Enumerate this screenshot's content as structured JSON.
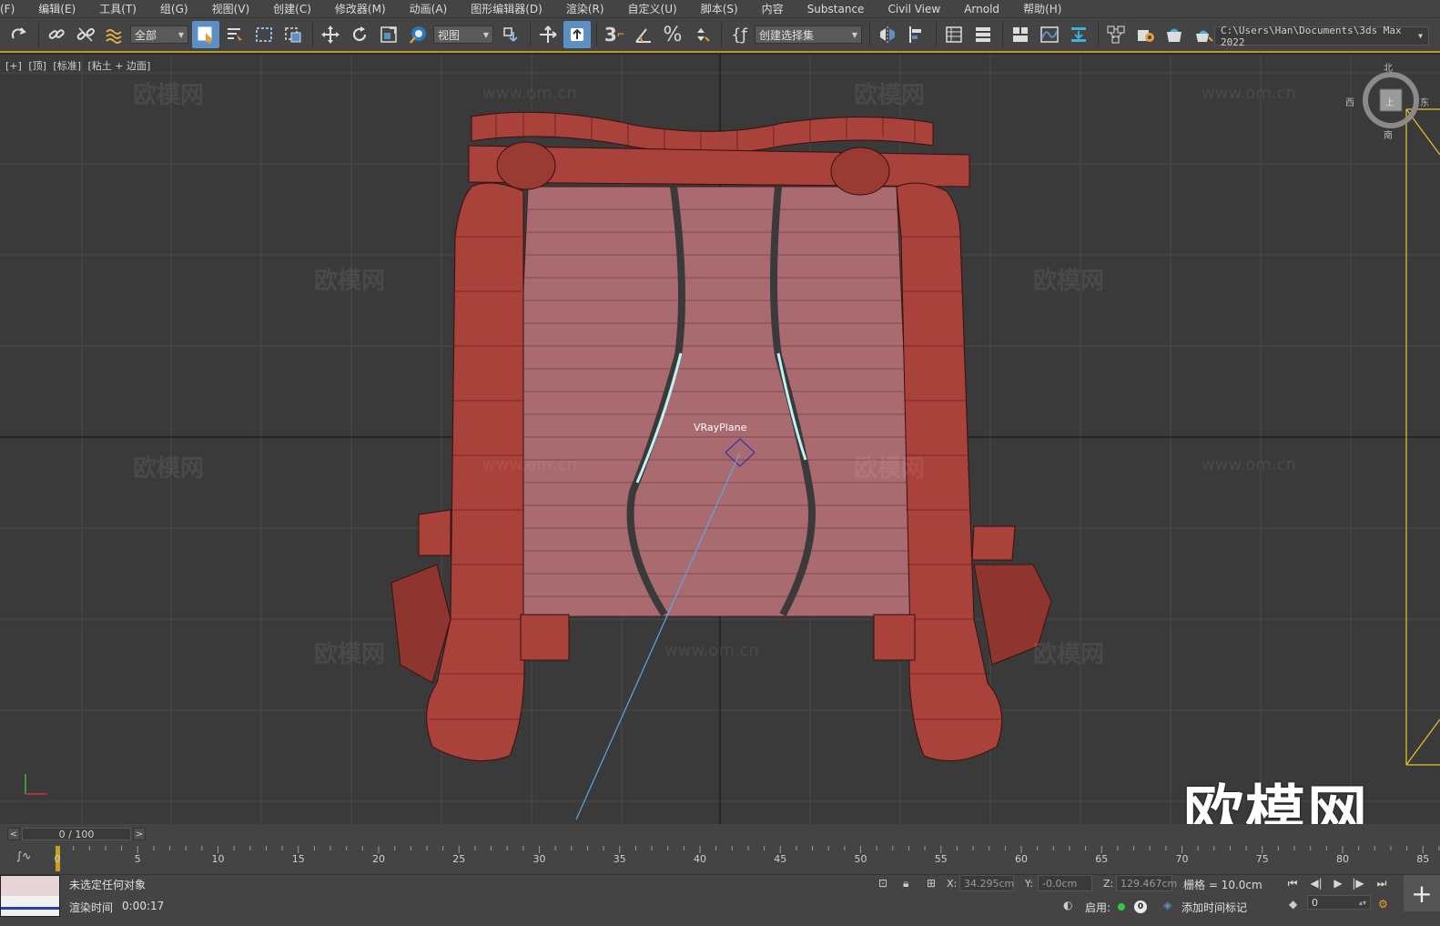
{
  "menu": [
    "(F)",
    "编辑(E)",
    "工具(T)",
    "组(G)",
    "视图(V)",
    "创建(C)",
    "修改器(M)",
    "动画(A)",
    "图形编辑器(D)",
    "渲染(R)",
    "自定义(U)",
    "脚本(S)",
    "内容",
    "Substance",
    "Civil View",
    "Arnold",
    "帮助(H)"
  ],
  "toolbar": {
    "filter_value": "全部",
    "refcoord_value": "视图",
    "selection_set_value": "创建选择集",
    "path_value": "C:\\Users\\Han\\Documents\\3ds Max 2022",
    "icons": [
      "redo-icon",
      "link-icon",
      "unlink-icon",
      "bind-spacewarp-icon",
      "select-object-icon",
      "select-by-name-icon",
      "rect-region-icon",
      "window-crossing-icon",
      "move-icon",
      "rotate-icon",
      "scale-icon",
      "placement-icon",
      "pivot-icon",
      "select-manipulate-icon",
      "keyboard-shortcut-override-icon",
      "snaps-3d-icon",
      "angle-snap-icon",
      "percent-snap-icon",
      "spinner-snap-icon",
      "edit-named-selection-icon",
      "mirror-icon",
      "align-icon",
      "scene-explorer-icon",
      "layer-explorer-icon",
      "toggle-ribbon-icon",
      "curve-editor-icon",
      "schematic-view-icon",
      "material-editor-icon",
      "render-setup-icon",
      "rendered-frame-icon",
      "render-production-icon"
    ]
  },
  "viewport": {
    "label": [
      "[+]",
      "[顶]",
      "[标准]",
      "[粘土 + 边面]"
    ],
    "object_label": "VRayPlane",
    "watermark_text": "欧模网",
    "watermark_url": "www.om.cn",
    "brand_watermark": "欧模网",
    "viewcube": {
      "north": "北",
      "south": "南",
      "west": "西",
      "east": "东",
      "face": "上"
    }
  },
  "timeslider": {
    "value": "0 / 100",
    "prev": "<",
    "next": ">"
  },
  "trackbar": {
    "ticks": [
      "0",
      "5",
      "10",
      "15",
      "20",
      "25",
      "30",
      "35",
      "40",
      "45",
      "50",
      "55",
      "60",
      "65",
      "70",
      "75",
      "80",
      "85"
    ],
    "current_frame": 0
  },
  "status": {
    "selection_text": "未选定任何对象",
    "render_time_label": "渲染时间",
    "render_time_value": "0:00:17",
    "x_label": "X:",
    "x_value": "34.295cm",
    "y_label": "Y:",
    "y_value": "-0.0cm",
    "z_label": "Z:",
    "z_value": "129.467cm",
    "grid_text": "栅格 = 10.0cm",
    "enable_label": "启用:",
    "enable_count": "0",
    "add_time_tag": "添加时间标记",
    "frame_value": "0"
  },
  "colors": {
    "accent": "#b89a1c",
    "active_button": "#5b8fc5",
    "model": "#a8423a",
    "model_seat": "#a96b70",
    "light_line": "#5aa8e6"
  }
}
